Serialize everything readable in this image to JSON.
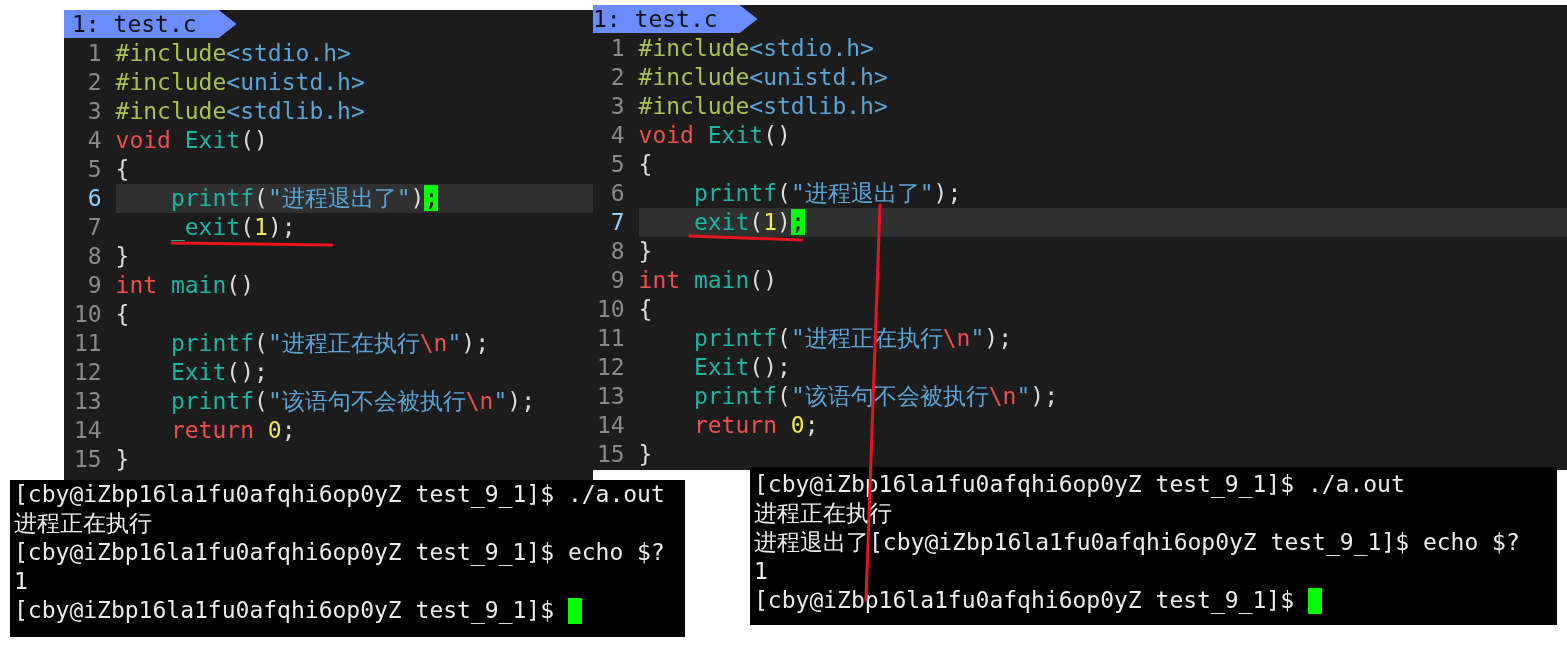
{
  "editors": [
    {
      "tab": {
        "label": "1: test.c"
      },
      "lines": [
        {
          "number": "1",
          "current": false,
          "tokens": [
            {
              "kind": "pre",
              "text": "#include"
            },
            {
              "kind": "hdr",
              "text": "<stdio.h>"
            }
          ]
        },
        {
          "number": "2",
          "current": false,
          "tokens": [
            {
              "kind": "pre",
              "text": "#include"
            },
            {
              "kind": "hdr",
              "text": "<unistd.h>"
            }
          ]
        },
        {
          "number": "3",
          "current": false,
          "tokens": [
            {
              "kind": "pre",
              "text": "#include"
            },
            {
              "kind": "hdr",
              "text": "<stdlib.h>"
            }
          ]
        },
        {
          "number": "4",
          "current": false,
          "tokens": [
            {
              "kind": "kw",
              "text": "void"
            },
            {
              "kind": "fn",
              "text": " Exit"
            },
            {
              "kind": "plain",
              "text": "()"
            }
          ]
        },
        {
          "number": "5",
          "current": false,
          "tokens": [
            {
              "kind": "plain",
              "text": "{"
            }
          ]
        },
        {
          "number": "6",
          "current": true,
          "tokens": [
            {
              "kind": "fn",
              "text": "    printf"
            },
            {
              "kind": "plain",
              "text": "("
            },
            {
              "kind": "str",
              "text": "\"进程退出了\""
            },
            {
              "kind": "plain",
              "text": ")"
            },
            {
              "kind": "cursor",
              "text": ";"
            }
          ]
        },
        {
          "number": "7",
          "current": false,
          "tokens": [
            {
              "kind": "fn",
              "text": "    _exit"
            },
            {
              "kind": "plain",
              "text": "("
            },
            {
              "kind": "num",
              "text": "1"
            },
            {
              "kind": "plain",
              "text": ");"
            }
          ]
        },
        {
          "number": "8",
          "current": false,
          "tokens": [
            {
              "kind": "plain",
              "text": "}"
            }
          ]
        },
        {
          "number": "9",
          "current": false,
          "tokens": [
            {
              "kind": "kw",
              "text": "int"
            },
            {
              "kind": "fn",
              "text": " main"
            },
            {
              "kind": "plain",
              "text": "()"
            }
          ]
        },
        {
          "number": "10",
          "current": false,
          "tokens": [
            {
              "kind": "plain",
              "text": "{"
            }
          ]
        },
        {
          "number": "11",
          "current": false,
          "tokens": [
            {
              "kind": "fn",
              "text": "    printf"
            },
            {
              "kind": "plain",
              "text": "("
            },
            {
              "kind": "str",
              "text": "\"进程正在执行"
            },
            {
              "kind": "esc",
              "text": "\\n"
            },
            {
              "kind": "str",
              "text": "\""
            },
            {
              "kind": "plain",
              "text": ");"
            }
          ]
        },
        {
          "number": "12",
          "current": false,
          "tokens": [
            {
              "kind": "fn",
              "text": "    Exit"
            },
            {
              "kind": "plain",
              "text": "();"
            }
          ]
        },
        {
          "number": "13",
          "current": false,
          "tokens": [
            {
              "kind": "fn",
              "text": "    printf"
            },
            {
              "kind": "plain",
              "text": "("
            },
            {
              "kind": "str",
              "text": "\"该语句不会被执行"
            },
            {
              "kind": "esc",
              "text": "\\n"
            },
            {
              "kind": "str",
              "text": "\""
            },
            {
              "kind": "plain",
              "text": ");"
            }
          ]
        },
        {
          "number": "14",
          "current": false,
          "tokens": [
            {
              "kind": "kw",
              "text": "    return"
            },
            {
              "kind": "num",
              "text": " 0"
            },
            {
              "kind": "plain",
              "text": ";"
            }
          ]
        },
        {
          "number": "15",
          "current": false,
          "tokens": [
            {
              "kind": "plain",
              "text": "}"
            }
          ]
        }
      ]
    },
    {
      "tab": {
        "label": "1: test.c"
      },
      "lines": [
        {
          "number": "1",
          "current": false,
          "tokens": [
            {
              "kind": "pre",
              "text": "#include"
            },
            {
              "kind": "hdr",
              "text": "<stdio.h>"
            }
          ]
        },
        {
          "number": "2",
          "current": false,
          "tokens": [
            {
              "kind": "pre",
              "text": "#include"
            },
            {
              "kind": "hdr",
              "text": "<unistd.h>"
            }
          ]
        },
        {
          "number": "3",
          "current": false,
          "tokens": [
            {
              "kind": "pre",
              "text": "#include"
            },
            {
              "kind": "hdr",
              "text": "<stdlib.h>"
            }
          ]
        },
        {
          "number": "4",
          "current": false,
          "tokens": [
            {
              "kind": "kw",
              "text": "void"
            },
            {
              "kind": "fn",
              "text": " Exit"
            },
            {
              "kind": "plain",
              "text": "()"
            }
          ]
        },
        {
          "number": "5",
          "current": false,
          "tokens": [
            {
              "kind": "plain",
              "text": "{"
            }
          ]
        },
        {
          "number": "6",
          "current": false,
          "tokens": [
            {
              "kind": "fn",
              "text": "    printf"
            },
            {
              "kind": "plain",
              "text": "("
            },
            {
              "kind": "str",
              "text": "\"进程退出了\""
            },
            {
              "kind": "plain",
              "text": ");"
            }
          ]
        },
        {
          "number": "7",
          "current": true,
          "tokens": [
            {
              "kind": "fn",
              "text": "    exit"
            },
            {
              "kind": "plain",
              "text": "("
            },
            {
              "kind": "num",
              "text": "1"
            },
            {
              "kind": "plain",
              "text": ")"
            },
            {
              "kind": "cursor",
              "text": ";"
            }
          ]
        },
        {
          "number": "8",
          "current": false,
          "tokens": [
            {
              "kind": "plain",
              "text": "}"
            }
          ]
        },
        {
          "number": "9",
          "current": false,
          "tokens": [
            {
              "kind": "kw",
              "text": "int"
            },
            {
              "kind": "fn",
              "text": " main"
            },
            {
              "kind": "plain",
              "text": "()"
            }
          ]
        },
        {
          "number": "10",
          "current": false,
          "tokens": [
            {
              "kind": "plain",
              "text": "{"
            }
          ]
        },
        {
          "number": "11",
          "current": false,
          "tokens": [
            {
              "kind": "fn",
              "text": "    printf"
            },
            {
              "kind": "plain",
              "text": "("
            },
            {
              "kind": "str",
              "text": "\"进程正在执行"
            },
            {
              "kind": "esc",
              "text": "\\n"
            },
            {
              "kind": "str",
              "text": "\""
            },
            {
              "kind": "plain",
              "text": ");"
            }
          ]
        },
        {
          "number": "12",
          "current": false,
          "tokens": [
            {
              "kind": "fn",
              "text": "    Exit"
            },
            {
              "kind": "plain",
              "text": "();"
            }
          ]
        },
        {
          "number": "13",
          "current": false,
          "tokens": [
            {
              "kind": "fn",
              "text": "    printf"
            },
            {
              "kind": "plain",
              "text": "("
            },
            {
              "kind": "str",
              "text": "\"该语句不会被执行"
            },
            {
              "kind": "esc",
              "text": "\\n"
            },
            {
              "kind": "str",
              "text": "\""
            },
            {
              "kind": "plain",
              "text": ");"
            }
          ]
        },
        {
          "number": "14",
          "current": false,
          "tokens": [
            {
              "kind": "kw",
              "text": "    return"
            },
            {
              "kind": "num",
              "text": " 0"
            },
            {
              "kind": "plain",
              "text": ";"
            }
          ]
        },
        {
          "number": "15",
          "current": false,
          "tokens": [
            {
              "kind": "plain",
              "text": "}"
            }
          ]
        }
      ]
    }
  ],
  "terminals": [
    {
      "lines": [
        {
          "text": "[cby@iZbp16la1fu0afqhi6op0yZ test_9_1]$ ./a.out",
          "cursor": false
        },
        {
          "text": "进程正在执行",
          "cursor": false
        },
        {
          "text": "[cby@iZbp16la1fu0afqhi6op0yZ test_9_1]$ echo $?",
          "cursor": false
        },
        {
          "text": "1",
          "cursor": false
        },
        {
          "text": "[cby@iZbp16la1fu0afqhi6op0yZ test_9_1]$ ",
          "cursor": true
        }
      ]
    },
    {
      "lines": [
        {
          "text": "[cby@iZbp16la1fu0afqhi6op0yZ test_9_1]$ ./a.out",
          "cursor": false
        },
        {
          "text": "进程正在执行",
          "cursor": false
        },
        {
          "text": "进程退出了[cby@iZbp16la1fu0afqhi6op0yZ test_9_1]$ echo $?",
          "cursor": false
        },
        {
          "text": "1",
          "cursor": false
        },
        {
          "text": "[cby@iZbp16la1fu0afqhi6op0yZ test_9_1]$ ",
          "cursor": true
        }
      ]
    }
  ]
}
